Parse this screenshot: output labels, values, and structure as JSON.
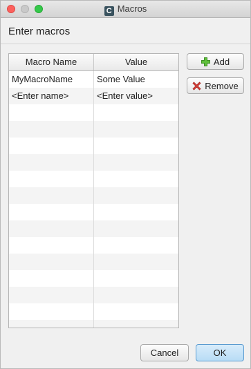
{
  "window": {
    "title": "Macros",
    "app_icon_letter": "C"
  },
  "heading": "Enter macros",
  "table": {
    "columns": [
      "Macro Name",
      "Value"
    ],
    "rows": [
      [
        "MyMacroName",
        "Some Value"
      ],
      [
        "<Enter name>",
        "<Enter value>"
      ]
    ]
  },
  "buttons": {
    "add": "Add",
    "remove": "Remove",
    "cancel": "Cancel",
    "ok": "OK"
  },
  "colors": {
    "add_icon": "#5fbf3b",
    "remove_icon": "#d9403a",
    "ok_accent": "#5a9bd0"
  }
}
